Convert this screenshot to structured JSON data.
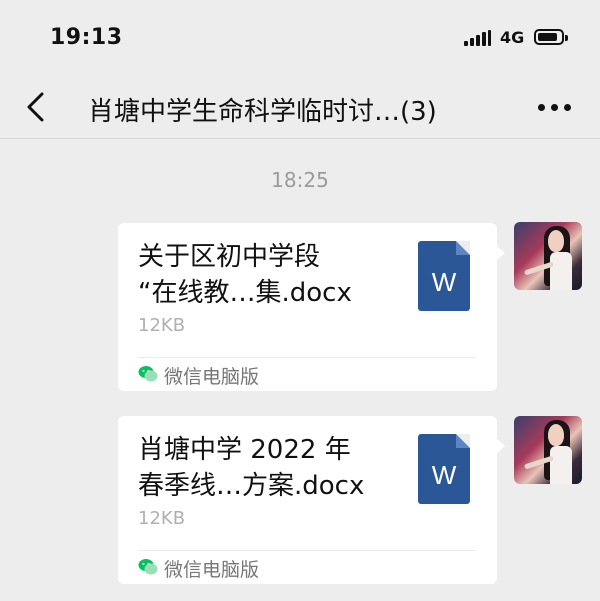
{
  "status": {
    "time": "19:13",
    "network": "4G"
  },
  "nav": {
    "title": "肖塘中学生命科学临时讨…(3)"
  },
  "messages": {
    "timestamp": "18:25",
    "items": [
      {
        "name_line1": "关于区初中学段",
        "name_line2": "“在线教…集.docx",
        "size": "12KB",
        "file_type_letter": "W",
        "source": "微信电脑版"
      },
      {
        "name_line1": "肖塘中学 2022 年",
        "name_line2": "春季线…方案.docx",
        "size": "12KB",
        "file_type_letter": "W",
        "source": "微信电脑版"
      }
    ]
  },
  "colors": {
    "background": "#ededed",
    "word_icon": "#2b5797",
    "wechat_green": "#07c160"
  }
}
